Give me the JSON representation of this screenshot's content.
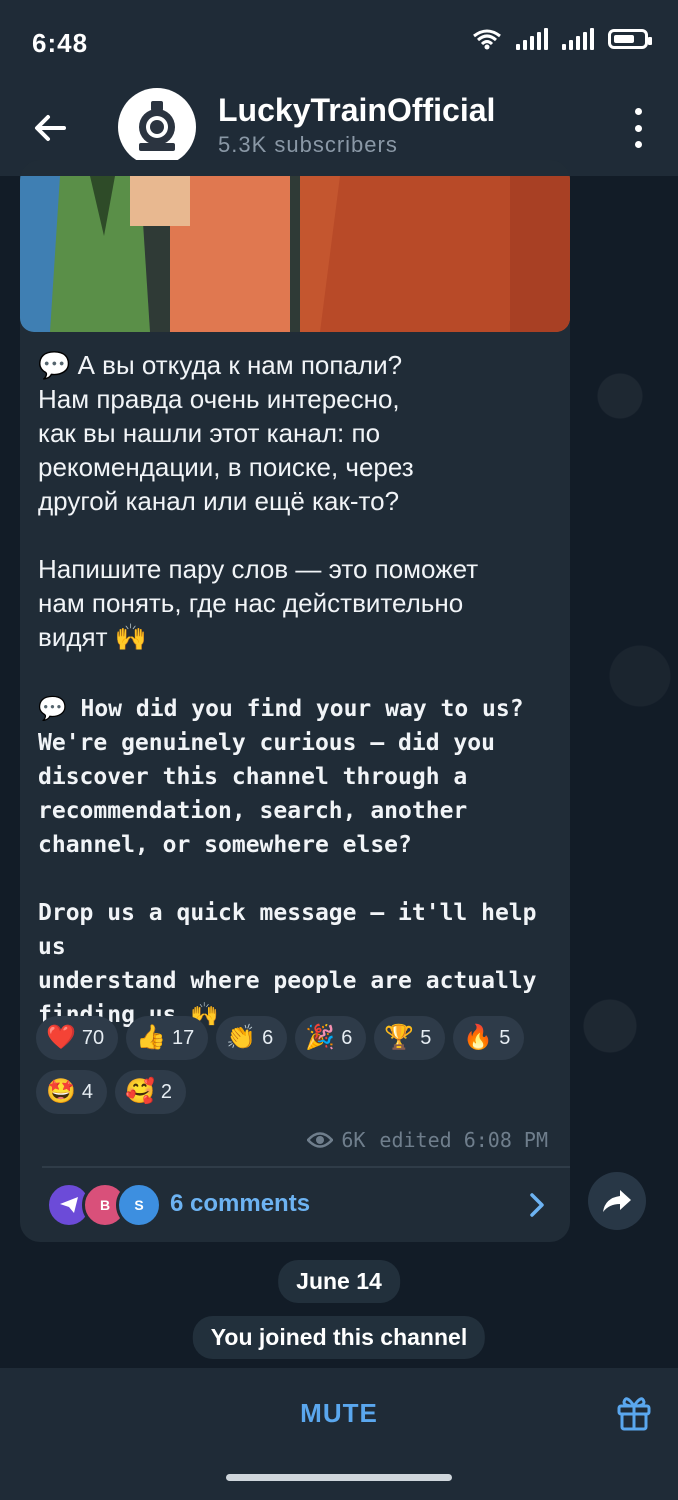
{
  "status_bar": {
    "time": "6:48"
  },
  "header": {
    "channel_name": "LuckyTrainOfficial",
    "subscribers": "5.3K subscribers"
  },
  "message": {
    "text_ru": "💬 А вы откуда к нам попали?\nНам правда очень интересно,\nкак вы нашли этот канал: по\nрекомендации, в поиске, через\nдругой канал или ещё как-то?\n\nНапишите пару слов — это поможет\nнам понять, где нас действительно\nвидят 🙌",
    "text_en": "💬 How did you find your way to us?\nWe're genuinely curious — did you\ndiscover this channel through a\nrecommendation, search, another\nchannel, or somewhere else?\n\nDrop us a quick message — it'll help us\nunderstand where people are actually\nfinding us 🙌",
    "reactions": [
      {
        "emoji": "❤️",
        "count": "70"
      },
      {
        "emoji": "👍",
        "count": "17"
      },
      {
        "emoji": "👏",
        "count": "6"
      },
      {
        "emoji": "🎉",
        "count": "6"
      },
      {
        "emoji": "🏆",
        "count": "5"
      },
      {
        "emoji": "🔥",
        "count": "5"
      },
      {
        "emoji": "🤩",
        "count": "4"
      },
      {
        "emoji": "🥰",
        "count": "2"
      }
    ],
    "views": "6K",
    "edited": "edited 6:08 PM",
    "comments": {
      "label": "6 comments",
      "avatars": [
        "B",
        "S"
      ]
    }
  },
  "date_separator": "June 14",
  "service_message": "You joined this channel",
  "bottom_bar": {
    "mute_label": "MUTE"
  },
  "colors": {
    "accent": "#5aa7ee",
    "header_bg": "#1f2b37",
    "bubble_bg": "#202c37",
    "like": "#e53935"
  }
}
